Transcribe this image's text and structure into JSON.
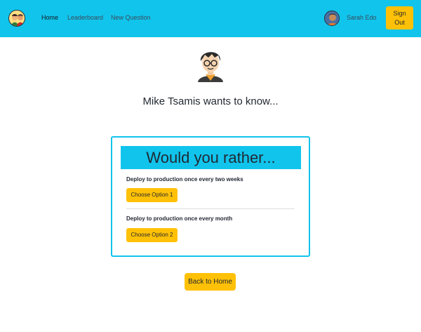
{
  "nav": {
    "links": [
      {
        "label": "Home",
        "active": true
      },
      {
        "label": "Leaderboard",
        "active": false
      },
      {
        "label": "New Question",
        "active": false
      }
    ],
    "user": {
      "name": "Sarah Edo"
    },
    "signout_label": "Sign Out"
  },
  "question": {
    "heading": "Mike Tsamis wants to know...",
    "card_title": "Would you rather...",
    "options": [
      {
        "text": "Deploy to production once every two weeks",
        "button_label": "Choose Option 1"
      },
      {
        "text": "Deploy to production once every month",
        "button_label": "Choose Option 2"
      }
    ]
  },
  "back_label": "Back to Home",
  "colors": {
    "nav_bg": "#11c4ec",
    "accent_button": "#ffc107",
    "card_border": "#11c4ec"
  },
  "icons": {
    "brand": "app-logo-icon",
    "user": "user-avatar-icon",
    "author": "author-avatar-icon"
  }
}
